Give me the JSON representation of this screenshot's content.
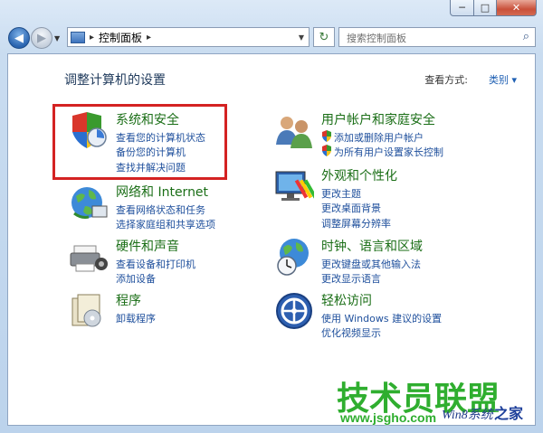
{
  "window": {
    "min_label": "─",
    "max_label": "□",
    "close_label": "✕"
  },
  "nav": {
    "back_label": "◀",
    "forward_label": "▶",
    "separator": "▸",
    "breadcrumb": "控制面板",
    "refresh_label": "↻",
    "search_placeholder": "搜索控制面板",
    "search_icon": "⌕"
  },
  "main": {
    "title": "调整计算机的设置",
    "view_by_label": "查看方式:",
    "view_by_value": "类别 ▾"
  },
  "categories": [
    {
      "key": "system",
      "heading": "系统和安全",
      "links": [
        "查看您的计算机状态",
        "备份您的计算机",
        "查找并解决问题"
      ]
    },
    {
      "key": "network",
      "heading": "网络和 Internet",
      "links": [
        "查看网络状态和任务",
        "选择家庭组和共享选项"
      ]
    },
    {
      "key": "hardware",
      "heading": "硬件和声音",
      "links": [
        "查看设备和打印机",
        "添加设备"
      ]
    },
    {
      "key": "programs",
      "heading": "程序",
      "links": [
        "卸载程序"
      ]
    },
    {
      "key": "users",
      "heading": "用户帐户和家庭安全",
      "links": [
        "添加或删除用户帐户",
        "为所有用户设置家长控制"
      ]
    },
    {
      "key": "appearance",
      "heading": "外观和个性化",
      "links": [
        "更改主题",
        "更改桌面背景",
        "调整屏幕分辨率"
      ]
    },
    {
      "key": "clock",
      "heading": "时钟、语言和区域",
      "links": [
        "更改键盘或其他输入法",
        "更改显示语言"
      ]
    },
    {
      "key": "ease",
      "heading": "轻松访问",
      "links": [
        "使用 Windows 建议的设置",
        "优化视频显示"
      ]
    }
  ],
  "watermark": {
    "brand": "技术员联盟",
    "url": "www.jsgho.com",
    "win_text": "Win8系统",
    "suffix": "之家"
  },
  "colors": {
    "heading_green": "#1a6e16",
    "link_blue": "#1e4f9c",
    "highlight_red": "#d42222"
  }
}
